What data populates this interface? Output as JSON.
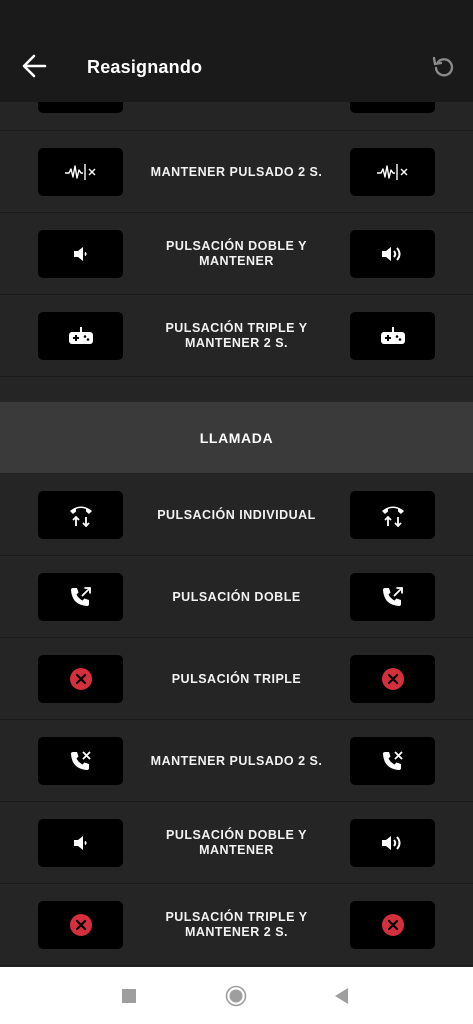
{
  "header": {
    "title": "Reasignando",
    "back_icon": "arrow-left-icon",
    "reset_icon": "reset-icon"
  },
  "top_rows": [
    {
      "label": "MANTENER PULSADO 2 S.",
      "left_icon": "voice-cancel-icon",
      "right_icon": "voice-cancel-icon"
    },
    {
      "label": "PULSACIÓN DOBLE Y MANTENER",
      "left_icon": "volume-down-icon",
      "right_icon": "volume-up-icon"
    },
    {
      "label": "PULSACIÓN TRIPLE Y MANTENER 2 S.",
      "left_icon": "gamepad-icon",
      "right_icon": "gamepad-icon"
    }
  ],
  "section": {
    "title": "LLAMADA"
  },
  "call_rows": [
    {
      "label": "PULSACIÓN INDIVIDUAL",
      "left_icon": "call-answer-end-icon",
      "right_icon": "call-answer-end-icon"
    },
    {
      "label": "PULSACIÓN DOBLE",
      "left_icon": "call-transfer-icon",
      "right_icon": "call-transfer-icon"
    },
    {
      "label": "PULSACIÓN TRIPLE",
      "left_icon": "disabled-icon",
      "right_icon": "disabled-icon"
    },
    {
      "label": "MANTENER PULSADO 2 S.",
      "left_icon": "call-reject-icon",
      "right_icon": "call-reject-icon"
    },
    {
      "label": "PULSACIÓN DOBLE Y MANTENER",
      "left_icon": "volume-down-icon",
      "right_icon": "volume-up-icon"
    },
    {
      "label": "PULSACIÓN TRIPLE Y MANTENER 2 S.",
      "left_icon": "disabled-icon",
      "right_icon": "disabled-icon"
    }
  ],
  "navbar": {
    "recents_icon": "square-recents-icon",
    "home_icon": "circle-home-icon",
    "back_icon": "triangle-back-icon"
  },
  "colors": {
    "background": "#252525",
    "topbar": "#1a1a1a",
    "section_header": "#3a3a3a",
    "icon_box": "#000000",
    "disabled_red": "#d32f3c"
  }
}
